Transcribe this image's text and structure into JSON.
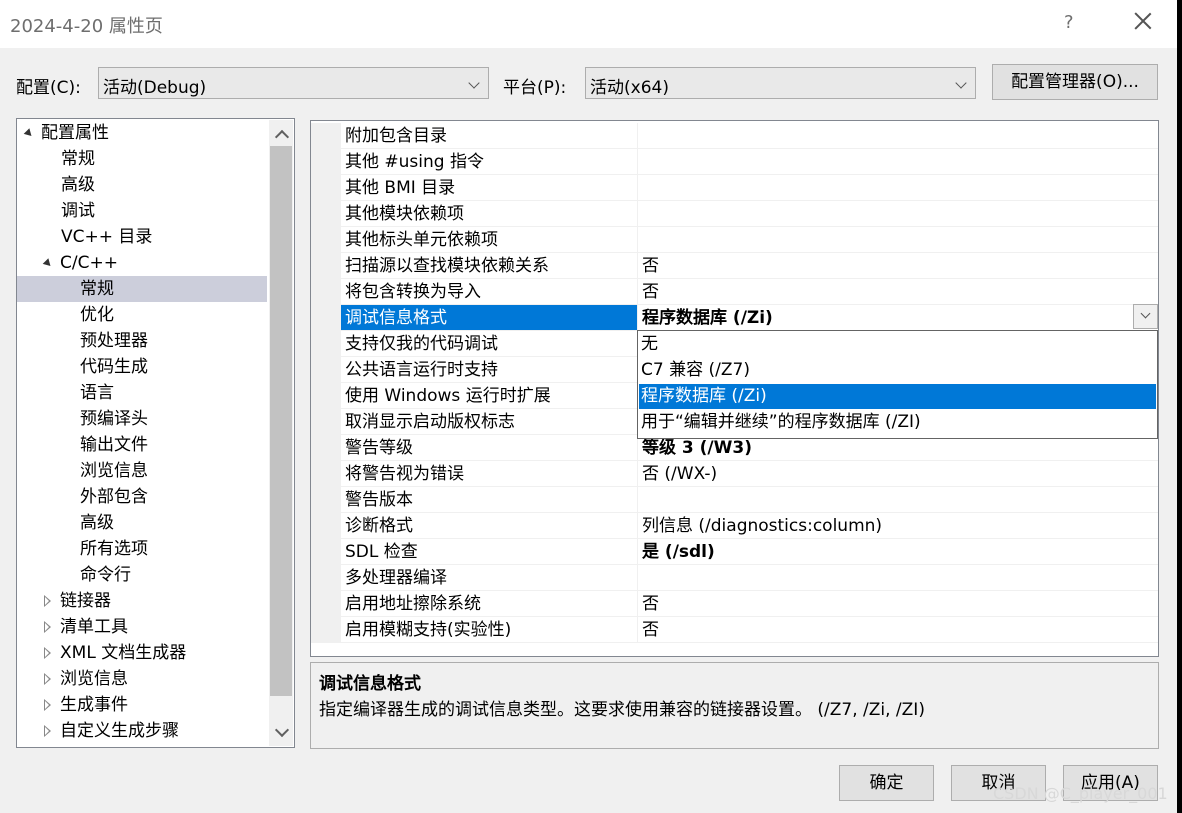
{
  "window": {
    "title": "2024-4-20 属性页",
    "help": "?"
  },
  "config": {
    "label": "配置(C):",
    "value": "活动(Debug)",
    "platform_label": "平台(P):",
    "platform_value": "活动(x64)",
    "manager_button": "配置管理器(O)..."
  },
  "tree": {
    "items": [
      {
        "label": "配置属性",
        "expander": "open"
      },
      {
        "label": "常规"
      },
      {
        "label": "高级"
      },
      {
        "label": "调试"
      },
      {
        "label": "VC++ 目录"
      },
      {
        "label": "C/C++",
        "expander": "open"
      },
      {
        "label": "常规",
        "selected": true
      },
      {
        "label": "优化"
      },
      {
        "label": "预处理器"
      },
      {
        "label": "代码生成"
      },
      {
        "label": "语言"
      },
      {
        "label": "预编译头"
      },
      {
        "label": "输出文件"
      },
      {
        "label": "浏览信息"
      },
      {
        "label": "外部包含"
      },
      {
        "label": "高级"
      },
      {
        "label": "所有选项"
      },
      {
        "label": "命令行"
      },
      {
        "label": "链接器",
        "expander": "closed"
      },
      {
        "label": "清单工具",
        "expander": "closed"
      },
      {
        "label": "XML 文档生成器",
        "expander": "closed"
      },
      {
        "label": "浏览信息",
        "expander": "closed"
      },
      {
        "label": "生成事件",
        "expander": "closed"
      },
      {
        "label": "自定义生成步骤",
        "expander": "closed"
      }
    ]
  },
  "grid": {
    "rows": [
      {
        "name": "附加包含目录",
        "value": ""
      },
      {
        "name": "其他 #using 指令",
        "value": ""
      },
      {
        "name": "其他 BMI 目录",
        "value": ""
      },
      {
        "name": "其他模块依赖项",
        "value": ""
      },
      {
        "name": "其他标头单元依赖项",
        "value": ""
      },
      {
        "name": "扫描源以查找模块依赖关系",
        "value": "否"
      },
      {
        "name": "将包含转换为导入",
        "value": "否"
      },
      {
        "name": "调试信息格式",
        "value": "程序数据库 (/Zi)",
        "bold": true,
        "selected": true
      },
      {
        "name": "支持仅我的代码调试",
        "value": ""
      },
      {
        "name": "公共语言运行时支持",
        "value": ""
      },
      {
        "name": "使用 Windows 运行时扩展",
        "value": ""
      },
      {
        "name": "取消显示启动版权标志",
        "value": ""
      },
      {
        "name": "警告等级",
        "value": "等级 3 (/W3)",
        "bold": true
      },
      {
        "name": "将警告视为错误",
        "value": "否 (/WX-)"
      },
      {
        "name": "警告版本",
        "value": ""
      },
      {
        "name": "诊断格式",
        "value": "列信息 (/diagnostics:column)"
      },
      {
        "name": "SDL 检查",
        "value": "是 (/sdl)",
        "bold": true
      },
      {
        "name": "多处理器编译",
        "value": ""
      },
      {
        "name": "启用地址擦除系统",
        "value": "否"
      },
      {
        "name": "启用模糊支持(实验性)",
        "value": "否"
      }
    ],
    "dropdown_options": [
      {
        "label": "无"
      },
      {
        "label": "C7 兼容 (/Z7)"
      },
      {
        "label": "程序数据库 (/Zi)",
        "highlighted": true
      },
      {
        "label": "用于“编辑并继续”的程序数据库 (/ZI)"
      }
    ]
  },
  "description": {
    "title": "调试信息格式",
    "text": "指定编译器生成的调试信息类型。这要求使用兼容的链接器设置。   (/Z7, /Zi, /ZI)"
  },
  "buttons": {
    "ok": "确定",
    "cancel": "取消",
    "apply": "应用(A)"
  },
  "watermark": "CSDN @C_player_001",
  "colors": {
    "selection": "#0078d7",
    "tree_selection": "#cccedb"
  }
}
